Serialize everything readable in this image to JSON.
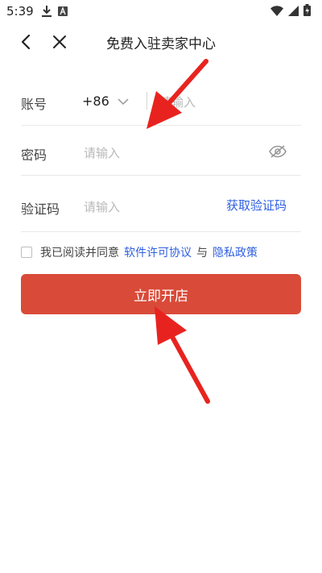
{
  "status_bar": {
    "time": "5:39",
    "icons": [
      "download-icon",
      "font-a-icon",
      "wifi-icon",
      "signal-icon",
      "battery-icon"
    ]
  },
  "header": {
    "title": "免费入驻卖家中心",
    "back_icon": "chevron-left-icon",
    "close_icon": "close-icon"
  },
  "form": {
    "account": {
      "label": "账号",
      "country_code": "+86",
      "placeholder": "请输入"
    },
    "password": {
      "label": "密码",
      "placeholder": "请输入"
    },
    "verify": {
      "label": "验证码",
      "placeholder": "请输入",
      "get_code": "获取验证码"
    }
  },
  "agreement": {
    "prefix": "我已阅读并同意",
    "license": "软件许可协议",
    "and": "与",
    "privacy": "隐私政策"
  },
  "submit_button": {
    "label": "立即开店"
  },
  "colors": {
    "accent": "#d94a38",
    "link": "#2f5fe0",
    "annotation": "#e8231f"
  }
}
